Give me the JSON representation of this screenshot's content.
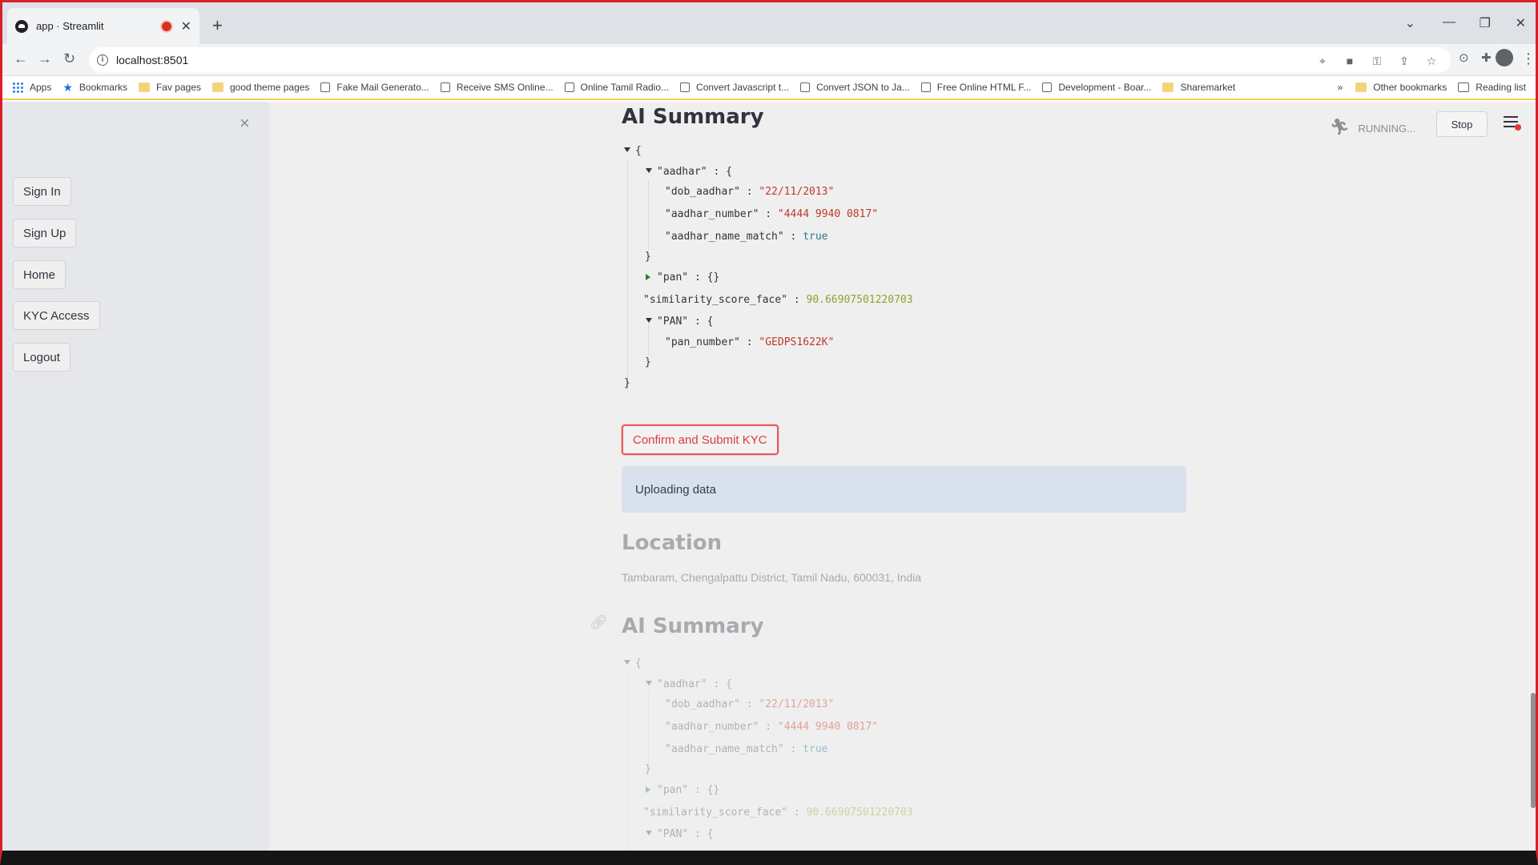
{
  "browser": {
    "tab_title": "app · Streamlit",
    "new_tab": "+",
    "url": "localhost:8501",
    "bookmarks": [
      {
        "label": "Apps",
        "icon": "apps-grid-icon"
      },
      {
        "label": "Bookmarks",
        "icon": "star-icon"
      },
      {
        "label": "Fav pages",
        "icon": "folder-icon"
      },
      {
        "label": "good theme pages",
        "icon": "folder-icon"
      },
      {
        "label": "Fake Mail Generato...",
        "icon": "mail-icon"
      },
      {
        "label": "Receive SMS Online...",
        "icon": "sms-icon"
      },
      {
        "label": "Online Tamil Radio...",
        "icon": "radio-icon"
      },
      {
        "label": "Convert Javascript t...",
        "icon": "convert-icon"
      },
      {
        "label": "Convert JSON to Ja...",
        "icon": "convert-icon"
      },
      {
        "label": "Free Online HTML F...",
        "icon": "html-icon"
      },
      {
        "label": "Development - Boar...",
        "icon": "gitlab-icon"
      },
      {
        "label": "Sharemarket",
        "icon": "folder-icon"
      }
    ],
    "bookmarks_more": "»",
    "other_bookmarks": "Other bookmarks",
    "reading_list": "Reading list"
  },
  "sidebar": {
    "close": "×",
    "buttons": [
      "Sign In",
      "Sign Up",
      "Home",
      "KYC Access",
      "Logout"
    ]
  },
  "header": {
    "status": "RUNNING...",
    "stop": "Stop"
  },
  "main": {
    "ai_summary_title": "AI Summary",
    "json": {
      "open": "{",
      "aadhar_key": "\"aadhar\"",
      "dob_key": "\"dob_aadhar\"",
      "dob_val": "\"22/11/2013\"",
      "num_key": "\"aadhar_number\"",
      "num_val": "\"4444 9940 0817\"",
      "match_key": "\"aadhar_name_match\"",
      "match_val": "true",
      "pan_key": "\"pan\"",
      "pan_val": "{}",
      "score_key": "\"similarity_score_face\"",
      "score_val": "90.66907501220703",
      "PAN_key": "\"PAN\"",
      "pan_number_key": "\"pan_number\"",
      "pan_number_val": "\"GEDPS1622K\"",
      "close": "}",
      "colon_open": ": {",
      "colon": ":"
    },
    "submit_button": "Confirm and Submit KYC",
    "info_message": "Uploading data",
    "location_title": "Location",
    "location_text": "Tambaram, Chengalpattu District, Tamil Nadu, 600031, India",
    "ai_summary_title_2": "AI Summary"
  }
}
